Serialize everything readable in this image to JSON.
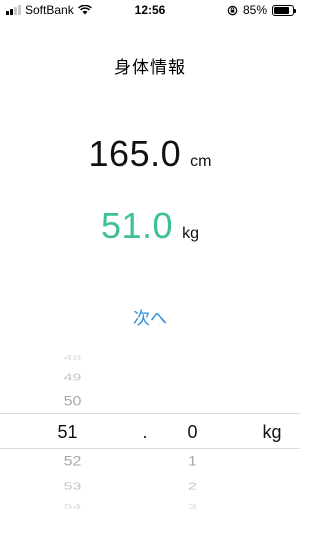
{
  "status_bar": {
    "carrier": "SoftBank",
    "time": "12:56",
    "battery_percent": "85%",
    "battery_level": 0.85,
    "icons": [
      "signal-icon",
      "wifi-icon",
      "rotation-lock-icon",
      "battery-icon"
    ]
  },
  "screen": {
    "title": "身体情報"
  },
  "height": {
    "value": "165.0",
    "unit": "cm"
  },
  "weight": {
    "value": "51.0",
    "unit": "kg",
    "color": "#3dbf98"
  },
  "next_button": {
    "label": "次へ",
    "color": "#2a8de0"
  },
  "picker": {
    "integer_above": [
      "48",
      "49",
      "50"
    ],
    "integer_selected": "51",
    "integer_below": [
      "52",
      "53",
      "54"
    ],
    "separator": ".",
    "decimal_selected": "0",
    "decimal_below": [
      "1",
      "2",
      "3"
    ],
    "unit": "kg"
  }
}
